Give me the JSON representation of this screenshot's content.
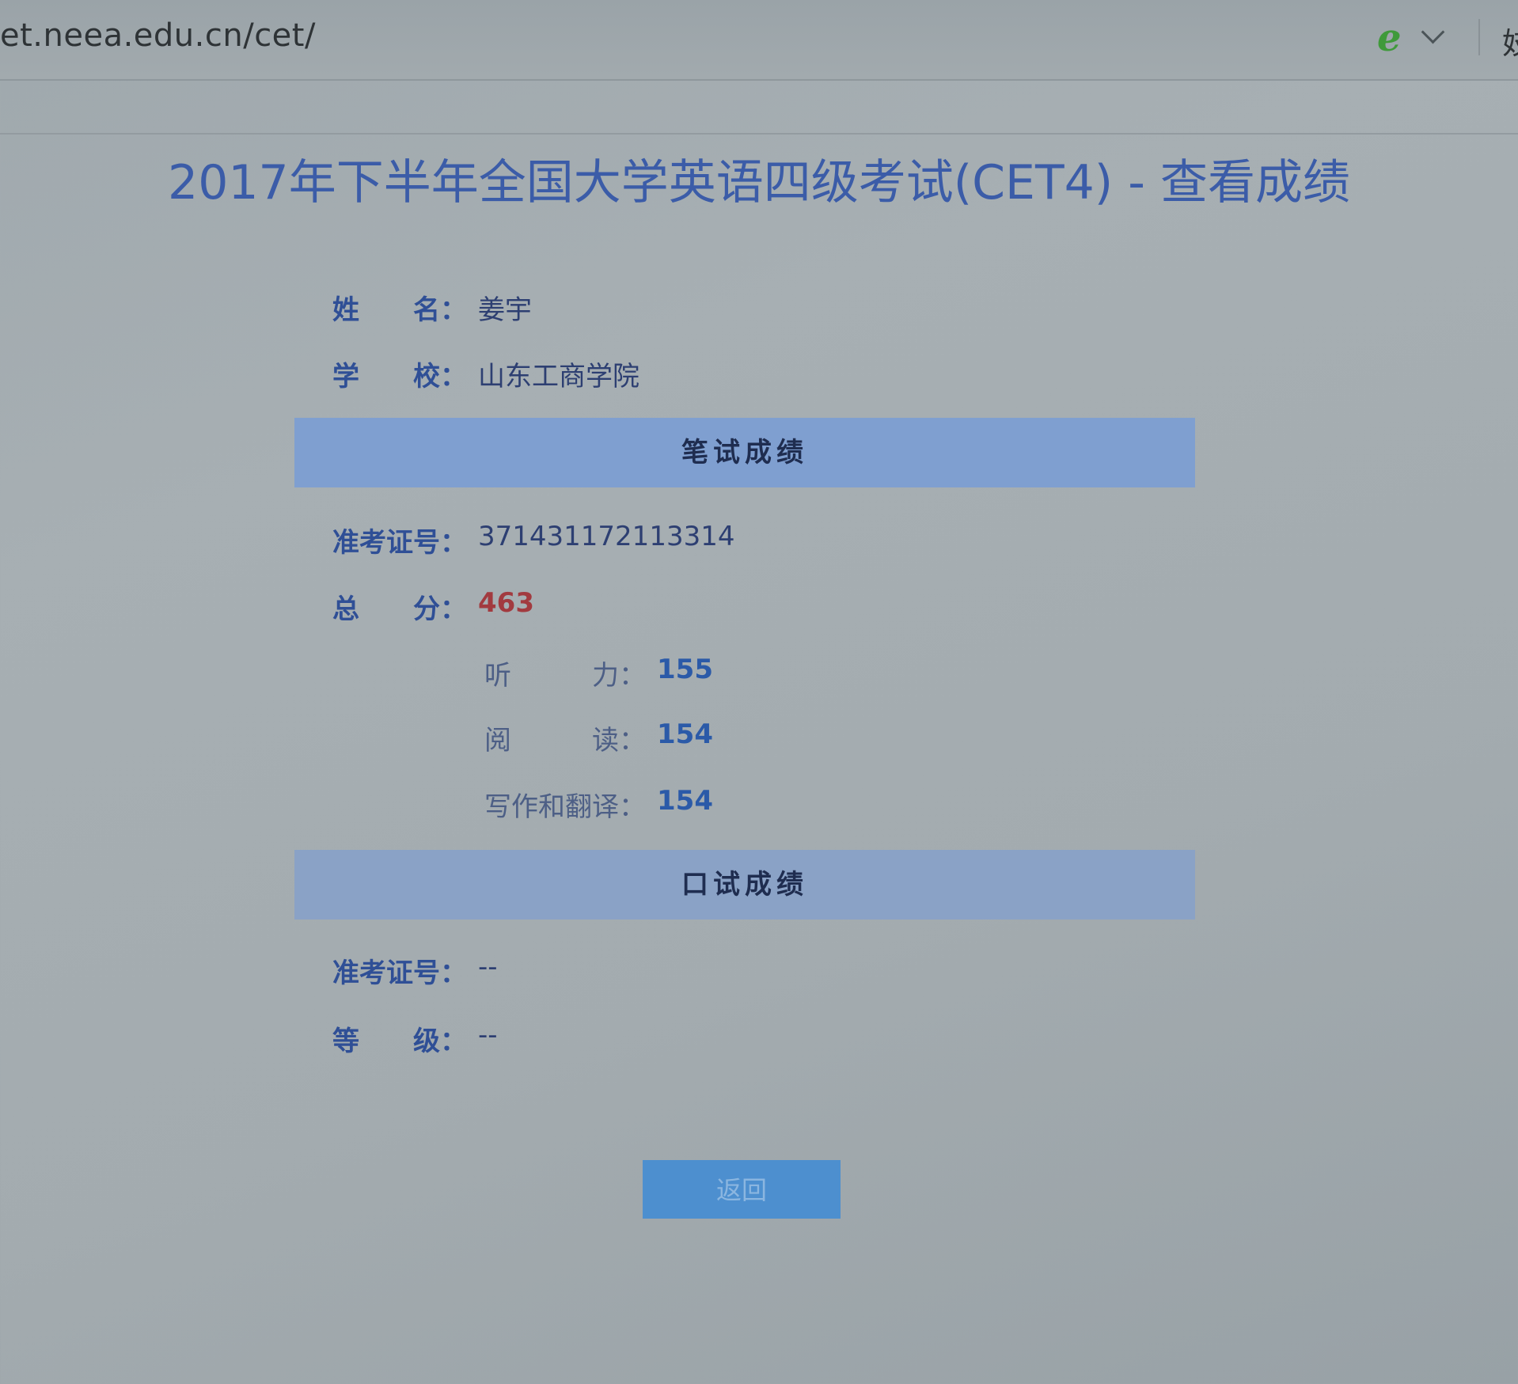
{
  "browser": {
    "url": "et.neea.edu.cn/cet/",
    "ie_icon": "e",
    "edge_char": "妓"
  },
  "page": {
    "title": "2017年下半年全国大学英语四级考试(CET4) - 查看成绩"
  },
  "candidate": {
    "name_label": "姓　　名：",
    "name_value": "姜宇",
    "school_label": "学　　校：",
    "school_value": "山东工商学院"
  },
  "written": {
    "header": "笔试成绩",
    "ticket_label": "准考证号：",
    "ticket_value": "371431172113314",
    "total_label": "总　　分：",
    "total_value": "463",
    "parts": [
      {
        "label": "听　　　力：",
        "value": "155"
      },
      {
        "label": "阅　　　读：",
        "value": "154"
      },
      {
        "label": "写作和翻译：",
        "value": "154"
      }
    ]
  },
  "oral": {
    "header": "口试成绩",
    "ticket_label": "准考证号：",
    "ticket_value": "--",
    "grade_label": "等　　级：",
    "grade_value": "--"
  },
  "actions": {
    "back_label": "返回"
  },
  "colors": {
    "title": "#3b5ca8",
    "label": "#2f4f96",
    "total": "#a23a3f",
    "section_bar": "#7f9fd0",
    "button": "#4d8fcf"
  }
}
